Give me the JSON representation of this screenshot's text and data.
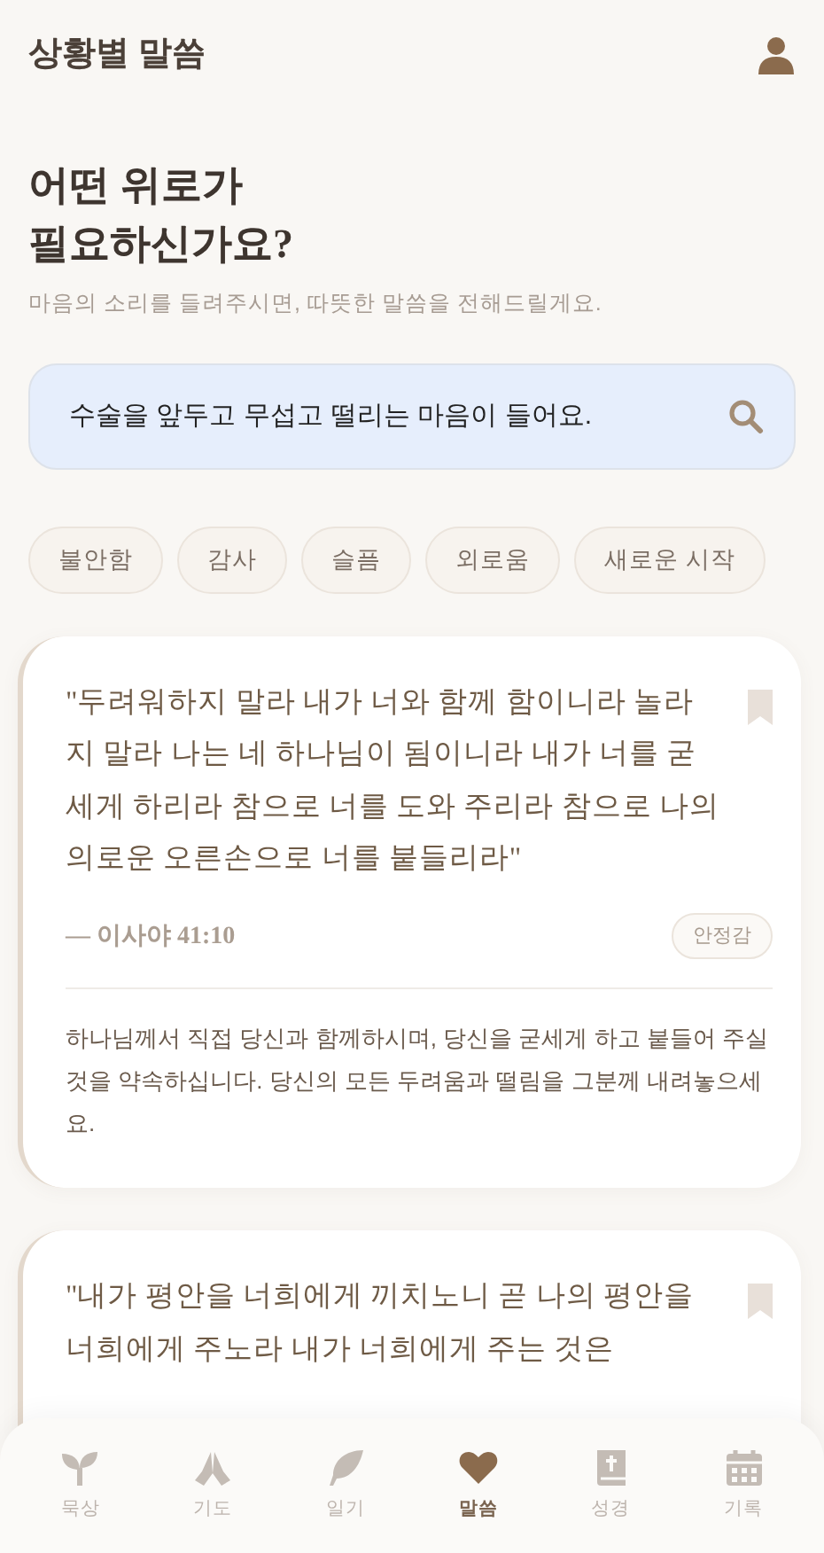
{
  "header": {
    "title": "상황별 말씀"
  },
  "heading_lines": [
    "어떤 위로가",
    "필요하신가요?"
  ],
  "subtitle": "마음의 소리를 들려주시면, 따뜻한 말씀을 전해드릴게요.",
  "search": {
    "value": "수술을 앞두고 무섭고 떨리는 마음이 들어요."
  },
  "chips": [
    "불안함",
    "감사",
    "슬픔",
    "외로움",
    "새로운 시작"
  ],
  "cards": [
    {
      "quote": "\"두려워하지 말라 내가 너와 함께 함이니라 놀라지 말라 나는 네 하나님이 됨이니라 내가 너를 굳세게 하리라 참으로 너를 도와 주리라 참으로 나의 의로운 오른손으로 너를 붙들리라\"",
      "reference": "— 이사야 41:10",
      "tag": "안정감",
      "note": "하나님께서 직접 당신과 함께하시며, 당신을 굳세게 하고 붙들어 주실 것을 약속하십니다. 당신의 모든 두려움과 떨림을 그분께 내려놓으세요."
    },
    {
      "quote": "\"내가 평안을 너희에게 끼치노니 곧 나의 평안을 너희에게 주노라 내가 너희에게 주는 것은"
    }
  ],
  "nav": [
    {
      "kind": "sprout",
      "label": "묵상",
      "selected": false
    },
    {
      "kind": "pray",
      "label": "기도",
      "selected": false
    },
    {
      "kind": "feather",
      "label": "일기",
      "selected": false
    },
    {
      "kind": "heart",
      "label": "말씀",
      "selected": true
    },
    {
      "kind": "bible",
      "label": "성경",
      "selected": false
    },
    {
      "kind": "calendar",
      "label": "기록",
      "selected": false
    }
  ]
}
